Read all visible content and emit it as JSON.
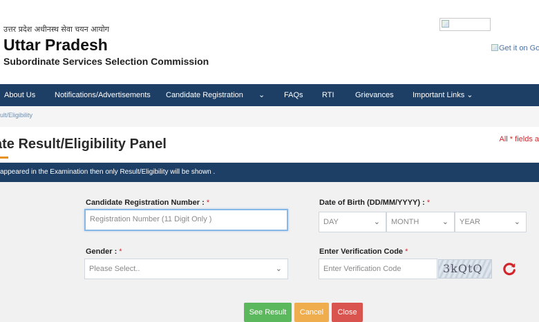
{
  "header": {
    "hindi_name": "उत्तर प्रदेश अधीनस्थ सेवा चयन आयोग",
    "title": "Uttar Pradesh",
    "subtitle": "Subordinate Services Selection Commission",
    "store_badge_alt": "Get it on Go"
  },
  "nav": {
    "items": [
      "About Us",
      "Notifications/Advertisements",
      "Candidate Registration",
      "⌄",
      "FAQs",
      "RTI",
      "Grievances",
      "Important Links ⌄"
    ]
  },
  "breadcrumb": "ult/Eligibility",
  "page": {
    "title": "ate Result/Eligibility Panel",
    "required_note": "All * fields a"
  },
  "banner": "appeared in the Examination then only Result/Eligibility will be shown .",
  "form": {
    "reg_label": "Candidate Registration Number :",
    "reg_placeholder": "Registration Number (11 Digit Only )",
    "dob_label": "Date of Birth (DD/MM/YYYY) :",
    "day": "DAY",
    "month": "MONTH",
    "year": "YEAR",
    "gender_label": "Gender :",
    "gender_value": "Please Select..",
    "captcha_label": "Enter Verification Code",
    "captcha_placeholder": "Enter Verification Code",
    "captcha_text": "3kQtQ",
    "required_mark": "*"
  },
  "buttons": {
    "see_result": "See Result",
    "cancel": "Cancel",
    "close": "Close"
  },
  "colors": {
    "nav_bg": "#1d3f66",
    "required": "#d2262d",
    "see_result": "#5cb85c",
    "cancel": "#f0ad4e",
    "close": "#d9534f"
  }
}
